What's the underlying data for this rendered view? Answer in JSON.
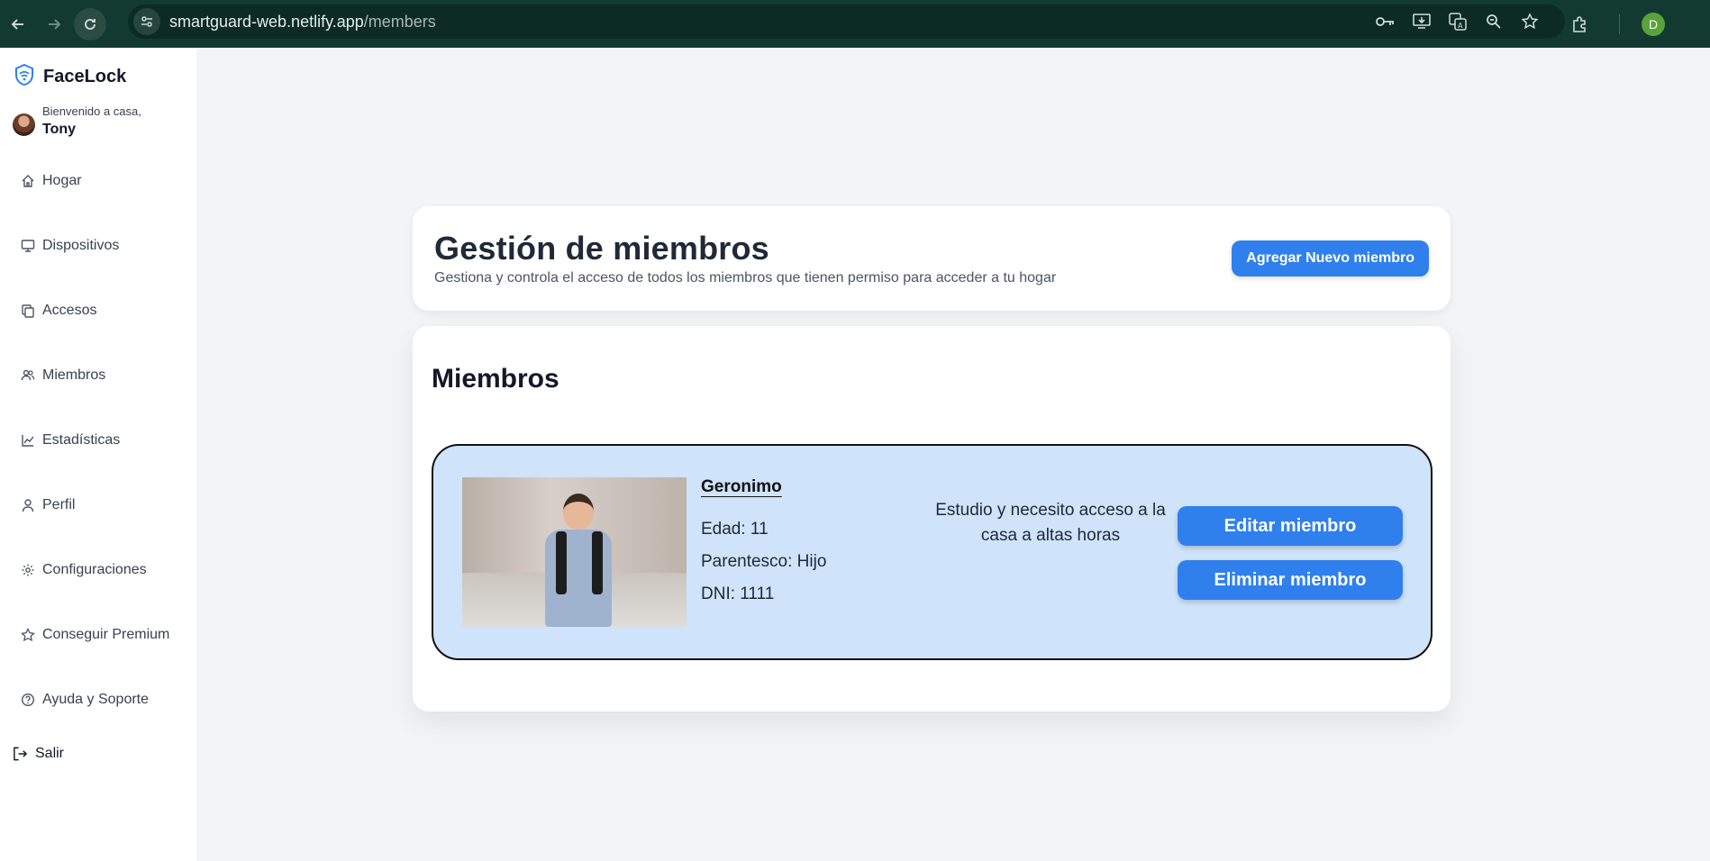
{
  "browser": {
    "url_host": "smartguard-web.netlify.app",
    "url_path": "/members",
    "profile_initial": "D"
  },
  "sidebar": {
    "brand": "FaceLock",
    "welcome": "Bienvenido a casa,",
    "user_name": "Tony",
    "items": [
      {
        "label": "Hogar",
        "icon": "home-icon"
      },
      {
        "label": "Dispositivos",
        "icon": "monitor-icon"
      },
      {
        "label": "Accesos",
        "icon": "copy-icon"
      },
      {
        "label": "Miembros",
        "icon": "users-icon"
      },
      {
        "label": "Estadísticas",
        "icon": "chart-icon"
      },
      {
        "label": "Perfil",
        "icon": "user-icon"
      },
      {
        "label": "Configuraciones",
        "icon": "gear-icon"
      },
      {
        "label": "Conseguir Premium",
        "icon": "star-icon"
      },
      {
        "label": "Ayuda y Soporte",
        "icon": "help-icon"
      }
    ],
    "logout": "Salir"
  },
  "header": {
    "title": "Gestión de miembros",
    "subtitle": "Gestiona y controla el acceso de todos los miembros que tienen permiso para acceder a tu hogar",
    "add_button": "Agregar Nuevo miembro"
  },
  "members_section": {
    "title": "Miembros",
    "members": [
      {
        "name": "Geronimo",
        "age": "Edad: 11",
        "relation": "Parentesco: Hijo",
        "dni": "DNI: 1111",
        "description": "Estudio y necesito acceso a la casa a altas horas",
        "edit_label": "Editar miembro",
        "delete_label": "Eliminar miembro"
      }
    ]
  },
  "colors": {
    "accent": "#2f80ed",
    "card_bg": "#cfe3fb",
    "chrome": "#123a30"
  }
}
